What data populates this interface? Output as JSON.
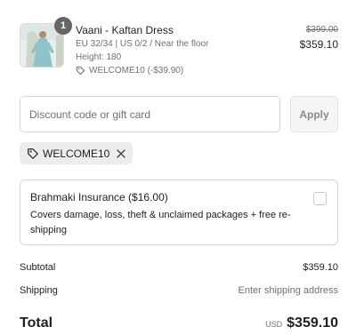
{
  "line_item": {
    "quantity": "1",
    "title": "Vaani - Kaftan Dress",
    "variant": "EU 32/34 | US 0/2 / Near the floor",
    "height": "Height: 180",
    "discount": "WELCOME10 (-$39.90)",
    "price_original": "$399.00",
    "price_final": "$359.10"
  },
  "discount_form": {
    "placeholder": "Discount code or gift card",
    "apply_label": "Apply"
  },
  "applied_code": "WELCOME10",
  "insurance": {
    "title": "Brahmaki Insurance ($16.00)",
    "description": "Covers damage, loss, theft & unclaimed packages + free re-shipping",
    "checked": false
  },
  "summary": {
    "subtotal_label": "Subtotal",
    "subtotal_value": "$359.10",
    "shipping_label": "Shipping",
    "shipping_value": "Enter shipping address",
    "total_label": "Total",
    "currency": "USD",
    "total_value": "$359.10"
  }
}
